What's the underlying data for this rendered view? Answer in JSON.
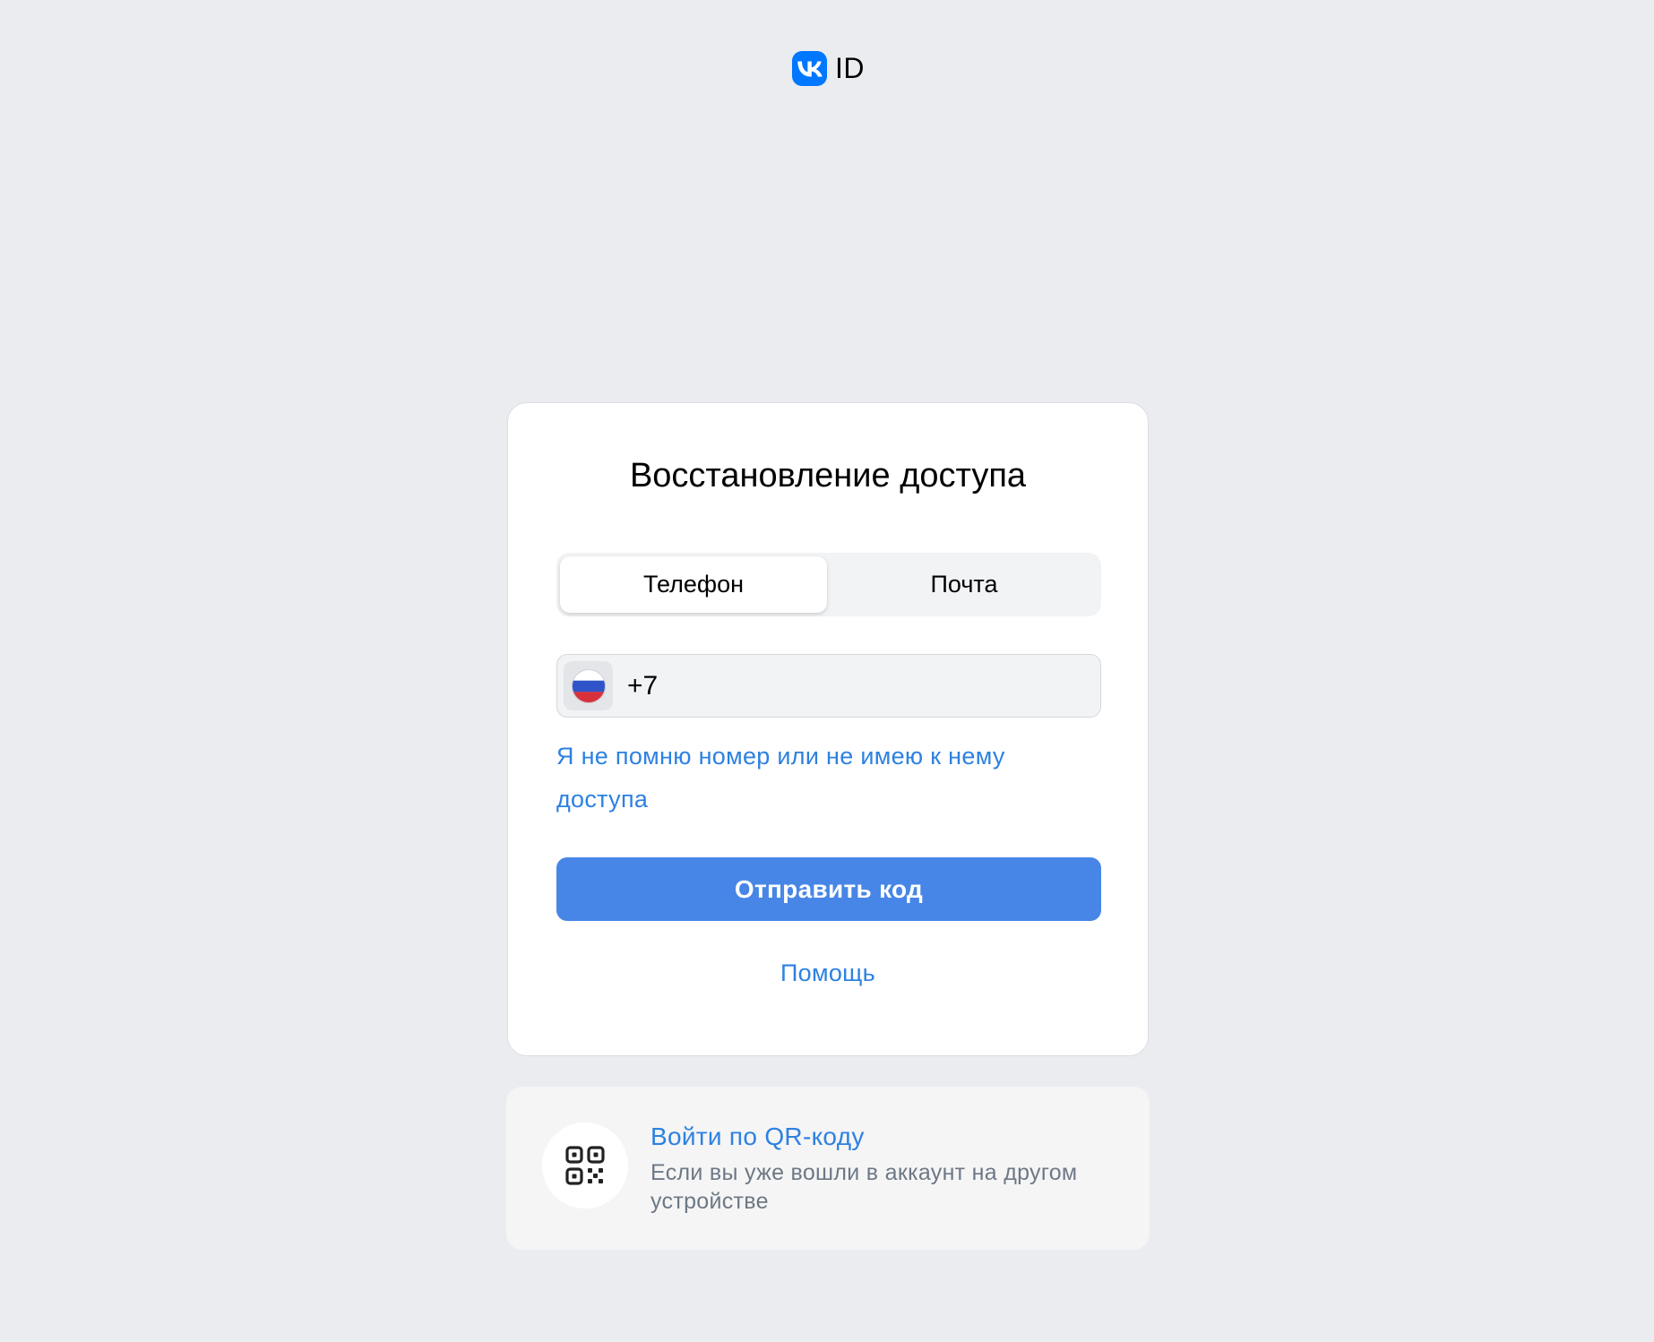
{
  "header": {
    "logo_icon": "vk-logo-icon",
    "logo_text": "ID",
    "brand_color": "#0077ff"
  },
  "card": {
    "title": "Восстановление доступа",
    "tabs": [
      {
        "label": "Телефон",
        "active": true
      },
      {
        "label": "Почта",
        "active": false
      }
    ],
    "phone": {
      "country_icon": "russia-flag-icon",
      "value": "+7"
    },
    "forgot_link": "Я не помню номер или не имею к нему доступа",
    "submit_label": "Отправить код",
    "help_link": "Помощь",
    "accent_color": "#4786e6",
    "link_color": "#2d81e0"
  },
  "qr": {
    "icon": "qr-code-icon",
    "title": "Войти по QR-коду",
    "subtitle": "Если вы уже вошли в аккаунт на другом устройстве"
  }
}
